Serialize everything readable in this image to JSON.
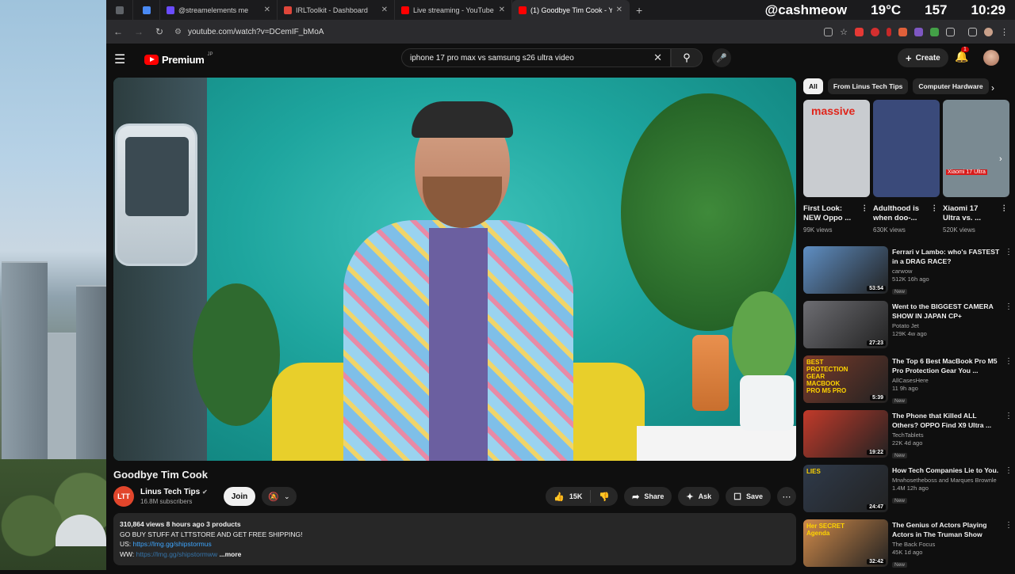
{
  "overlay": {
    "handle": "@cashmeow",
    "temp": "19°C",
    "count": "157",
    "time": "10:29"
  },
  "tabs": [
    {
      "label": "",
      "color": "#5f6368",
      "pinned": true
    },
    {
      "label": "",
      "color": "#4a8af4",
      "pinned": true
    },
    {
      "label": "@streamelements me",
      "color": "#6a4cff"
    },
    {
      "label": "IRLToolkit - Dashboard",
      "color": "#e0463a"
    },
    {
      "label": "Live streaming - YouTube Stu",
      "color": "#ff0000"
    },
    {
      "label": "(1) Goodbye Tim Cook - Y",
      "color": "#ff0000",
      "active": true
    }
  ],
  "address": {
    "url": "youtube.com/watch?v=DCemIF_bMoA"
  },
  "header": {
    "brand": "Premium",
    "region": "JP",
    "search_value": "iphone 17 pro max vs samsung s26 ultra video",
    "create_label": "Create",
    "notif_count": "1"
  },
  "video": {
    "title": "Goodbye Tim Cook",
    "channel": "Linus Tech Tips",
    "channel_initials": "LTT",
    "subscribers": "16.8M subscribers",
    "join_label": "Join",
    "likes": "15K",
    "share_label": "Share",
    "ask_label": "Ask",
    "save_label": "Save"
  },
  "description": {
    "stats": "310,864 views  8 hours ago  3 products",
    "line1": "GO BUY STUFF AT LTTSTORE AND GET FREE SHIPPING!",
    "us_prefix": "US: ",
    "us_link": "https://lmg.gg/shipstormus",
    "ww_prefix": "WW: ",
    "ww_link": "https://lmg.gg/shipstormww",
    "more": "...more"
  },
  "chips": [
    "All",
    "From Linus Tech Tips",
    "Computer Hardware"
  ],
  "shorts": [
    {
      "title": "First Look:\nNEW Oppo ...",
      "views": "99K views",
      "badge": "massive",
      "bg": "#c9ccd0"
    },
    {
      "title": "Adulthood is\nwhen doo-...",
      "views": "630K views",
      "badge": "",
      "bg": "#3a4a7a"
    },
    {
      "title": "Xiaomi 17\nUltra vs. ...",
      "views": "520K views",
      "badge": "Xiaomi 17 Ultra",
      "bg": "#7a8a92"
    }
  ],
  "recs": [
    {
      "title": "Ferrari v Lambo: who's FASTEST in a DRAG RACE?",
      "channel": "carwow",
      "stats": "512K  16h ago",
      "dur": "53:54",
      "new": "New",
      "bg": "#5f8fc4"
    },
    {
      "title": "Went to the BIGGEST CAMERA SHOW IN JAPAN CP+",
      "channel": "Potato Jet",
      "stats": "129K  4w ago",
      "dur": "27:23",
      "new": "",
      "bg": "#6d6d72"
    },
    {
      "title": "The Top 6 Best MacBook Pro M5 Pro Protection Gear You ...",
      "channel": "AllCasesHere",
      "stats": "11  9h ago",
      "dur": "5:39",
      "new": "New",
      "bg": "#7a3a2a",
      "overlay": "BEST PROTECTION GEAR MACBOOK PRO M5 PRO"
    },
    {
      "title": "The Phone that Killed ALL Others? OPPO Find X9 Ultra ...",
      "channel": "TechTablets",
      "stats": "22K  4d ago",
      "dur": "19:22",
      "new": "New",
      "bg": "#c23a2a"
    },
    {
      "title": "How Tech Companies Lie to You.",
      "channel": "Mrwhosetheboss and Marques Brownle",
      "stats": "1.4M  12h ago",
      "dur": "24:47",
      "new": "New",
      "bg": "#2f3a4a",
      "overlay": "LIES"
    },
    {
      "title": "The Genius of Actors Playing Actors in The Truman Show",
      "channel": "The Back Focus",
      "stats": "45K  1d ago",
      "dur": "32:42",
      "new": "New",
      "bg": "#d08a4a",
      "overlay": "Her SECRET Agenda"
    }
  ],
  "icons": {
    "menu": "hamburger-icon",
    "search": "magnifier-icon",
    "mic": "microphone-icon",
    "bell": "bell-icon",
    "like": "thumbs-up-icon",
    "dislike": "thumbs-down-icon"
  }
}
